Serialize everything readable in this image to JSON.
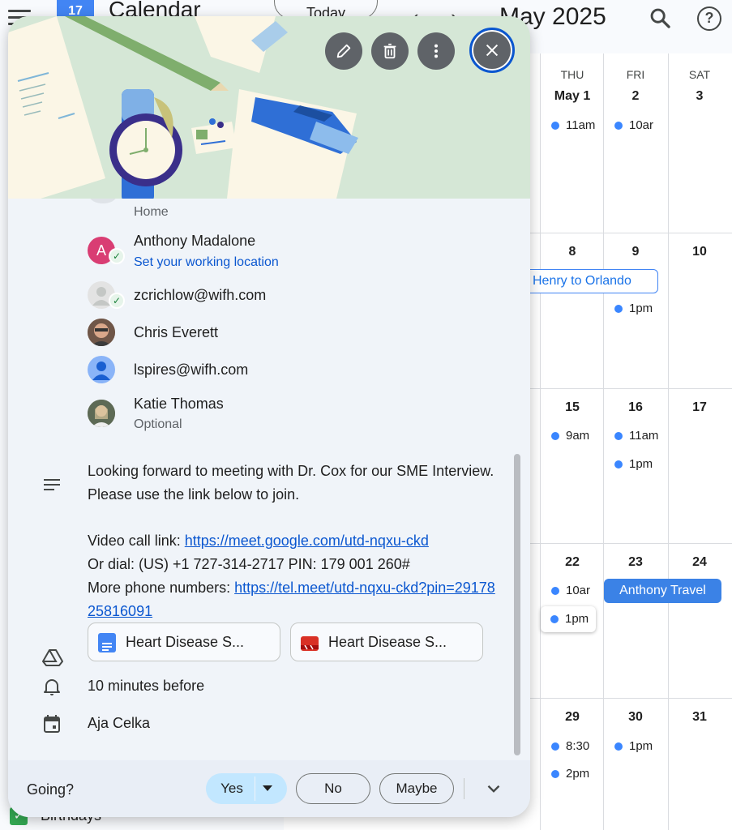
{
  "app": {
    "title": "Calendar",
    "logo_text": "17",
    "today_label": "Today",
    "prev_icon": "‹",
    "next_icon": "›",
    "month_title": "May 2025",
    "help_glyph": "?"
  },
  "calendar": {
    "days_of_week": [
      "THU",
      "FRI",
      "SAT"
    ],
    "date_rows": [
      [
        "May 1",
        "2",
        "3"
      ],
      [
        "8",
        "9",
        "10"
      ],
      [
        "15",
        "16",
        "17"
      ],
      [
        "22",
        "23",
        "24"
      ],
      [
        "29",
        "30",
        "31"
      ]
    ],
    "events": {
      "thu_1": "11am",
      "fri_2": "10ar",
      "henry_chip": "Henry to Orlando",
      "fri_9": "1pm",
      "thu_15": "9am",
      "fri_16_a": "11am",
      "fri_16_b": "1pm",
      "thu_22_a": "10ar",
      "thu_22_b": "1pm",
      "anthony_chip": "Anthony Travel",
      "thu_29_a": "8:30",
      "thu_29_b": "2pm",
      "fri_30": "1pm"
    },
    "sidebar_birthdays": "Birthdays",
    "accent_color": "#3a86ff"
  },
  "popup": {
    "toolbar": {
      "edit_icon": "pencil-icon",
      "delete_icon": "trash-icon",
      "more_icon": "more-vert-icon",
      "close_icon": "close-icon"
    },
    "guests": {
      "partial_location": "Home",
      "items": [
        {
          "name": "Anthony Madalone",
          "sub": "Set your working location",
          "avatar_letter": "A"
        },
        {
          "name": "zcrichlow@wifh.com",
          "sub": ""
        },
        {
          "name": "Chris Everett",
          "sub": ""
        },
        {
          "name": "lspires@wifh.com",
          "sub": ""
        },
        {
          "name": "Katie Thomas",
          "sub": "Optional"
        }
      ]
    },
    "description": {
      "line1": "Looking forward to meeting with Dr. Cox for our SME Interview. Please use the link below to join.",
      "video_prefix": "Video call link: ",
      "video_link": "https://meet.google.com/utd-nqxu-ckd",
      "dial": "Or dial: (US) +1 727-314-2717 PIN: 179 001 260#",
      "phone_prefix": "More phone numbers: ",
      "phone_link": "https://tel.meet/utd-nqxu-ckd?pin=2917825816091"
    },
    "attachments": [
      {
        "label": "Heart Disease S...",
        "type": "doc"
      },
      {
        "label": "Heart Disease S...",
        "type": "video"
      }
    ],
    "reminder": "10 minutes before",
    "organizer": "Aja Celka",
    "rsvp": {
      "going_label": "Going?",
      "yes": "Yes",
      "no": "No",
      "maybe": "Maybe"
    }
  }
}
